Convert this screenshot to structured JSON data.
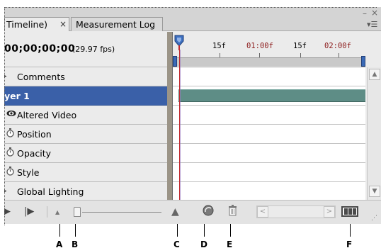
{
  "tabs": [
    {
      "label": "Timeline)",
      "close": "×"
    },
    {
      "label": "Measurement Log"
    }
  ],
  "window_controls": {
    "minimize": "–",
    "close": "×",
    "menu": "▾☰"
  },
  "timecode": {
    "value": "00;00;00;00",
    "fps": "(29.97 fps)"
  },
  "ruler": {
    "labels": [
      "15f",
      "01:00f",
      "15f",
      "02:00f"
    ]
  },
  "rows": [
    {
      "label": "Comments",
      "icon": "expand-triangle-icon"
    },
    {
      "label": "yer 1",
      "selected": true
    },
    {
      "label": "Altered Video",
      "icon": "eye-icon"
    },
    {
      "label": "Position",
      "icon": "stopwatch-icon"
    },
    {
      "label": "Opacity",
      "icon": "stopwatch-icon"
    },
    {
      "label": "Style",
      "icon": "stopwatch-icon"
    },
    {
      "label": "Global Lighting",
      "icon": "expand-triangle-icon"
    }
  ],
  "toolbar": {
    "play": "▶",
    "step_forward": "|▶",
    "zoom_out": "▲",
    "zoom_in": "▲",
    "hscroll_left": "<",
    "hscroll_right": ">"
  },
  "callouts": [
    "A",
    "B",
    "C",
    "D",
    "E",
    "F"
  ],
  "colors": {
    "selection": "#3a60a8",
    "layer_bar": "#5e8d86",
    "playhead": "#c0282d",
    "work_area_handle": "#3b6ab6"
  }
}
